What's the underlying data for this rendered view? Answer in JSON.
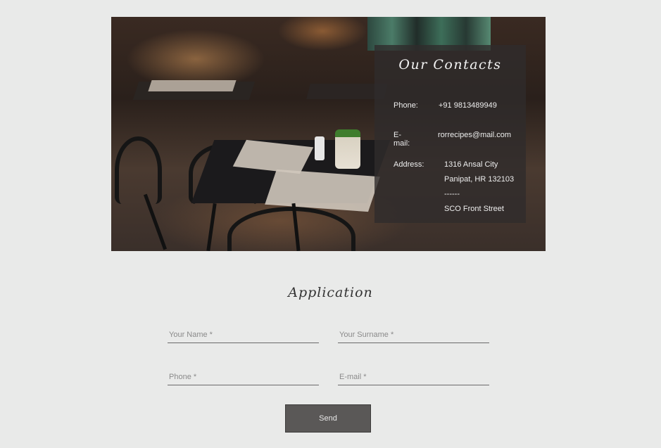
{
  "contacts": {
    "title": "Our Contacts",
    "phone_label": "Phone:",
    "phone_value": "+91 9813489949",
    "email_label": "E-mail:",
    "email_value": "rorrecipes@mail.com",
    "address_label": "Address:",
    "address_lines": [
      "1316 Ansal City",
      "Panipat, HR 132103",
      "------",
      "SCO Front Street"
    ]
  },
  "application": {
    "title": "Application",
    "name_placeholder": "Your Name *",
    "surname_placeholder": "Your Surname *",
    "phone_placeholder": "Phone *",
    "email_placeholder": "E-mail *",
    "send_label": "Send"
  },
  "colors": {
    "page_bg": "#e9eae9",
    "overlay_bg": "#302c2c",
    "button_bg": "#5a5857"
  }
}
